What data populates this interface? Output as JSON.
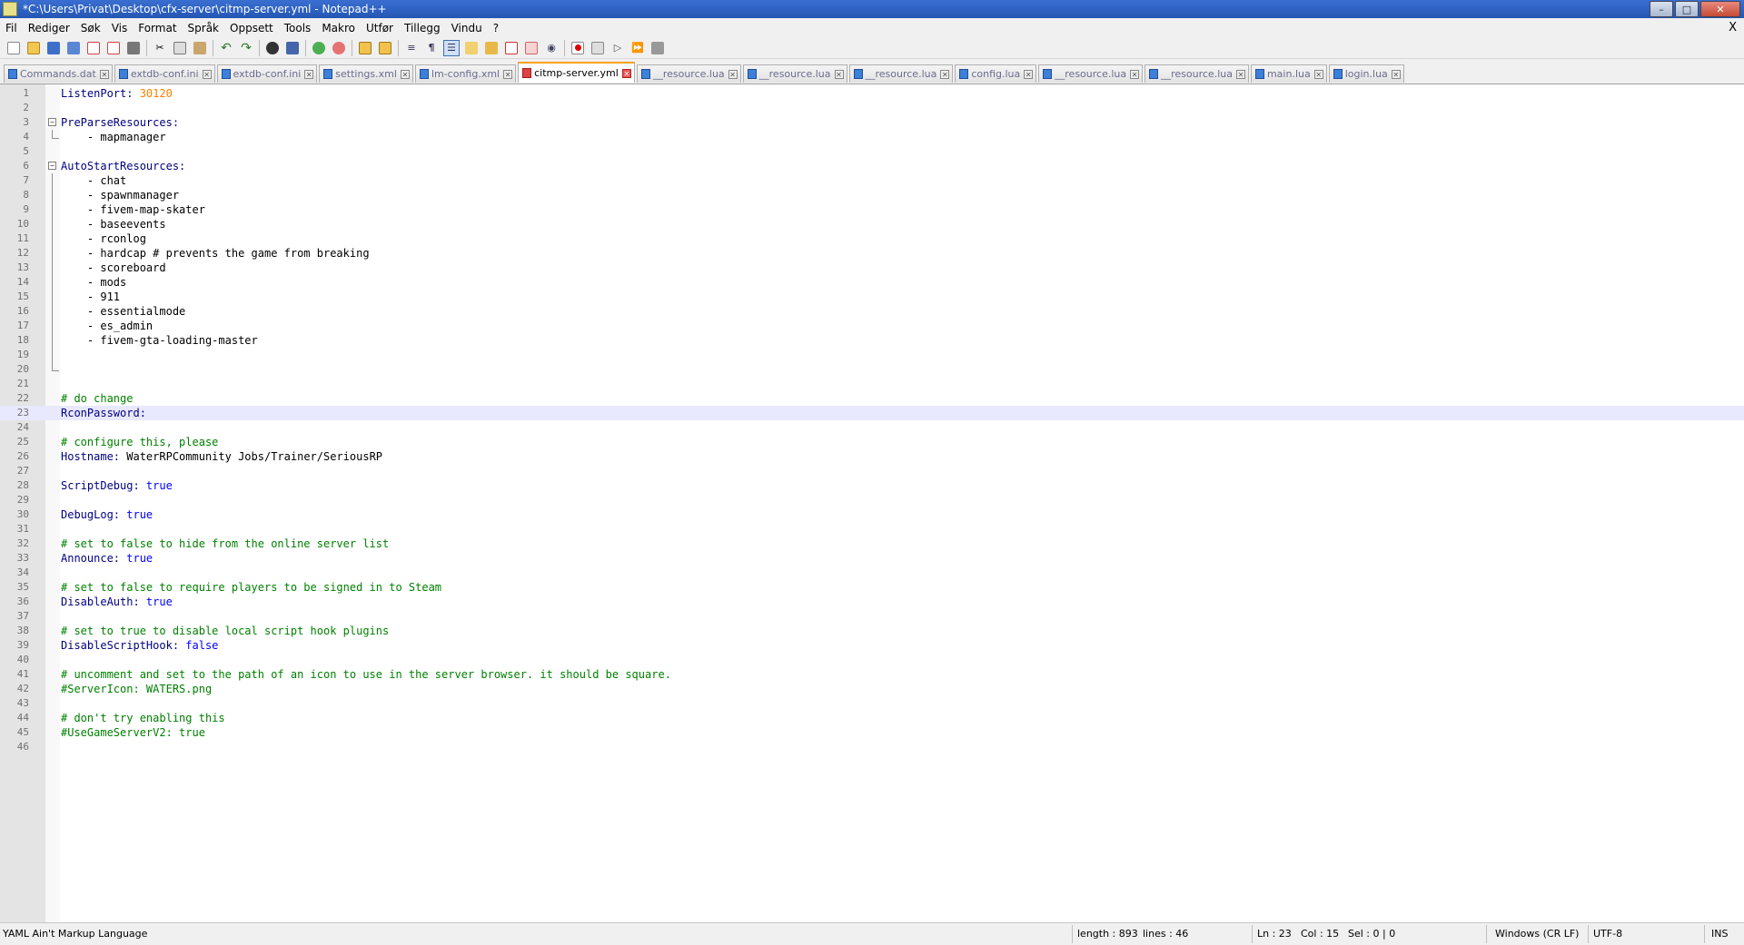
{
  "window": {
    "title": "*C:\\Users\\Privat\\Desktop\\cfx-server\\citmp-server.yml - Notepad++",
    "minimize": "–",
    "maximize": "□",
    "close": "✕"
  },
  "menu": {
    "items": [
      "Fil",
      "Rediger",
      "Søk",
      "Vis",
      "Format",
      "Språk",
      "Oppsett",
      "Tools",
      "Makro",
      "Utfør",
      "Tillegg",
      "Vindu",
      "?"
    ],
    "close": "X"
  },
  "toolbar": {
    "icons": [
      "new-file-icon",
      "open-file-icon",
      "save-icon",
      "save-all-icon",
      "close-icon",
      "close-all-icon",
      "print-icon",
      "cut-icon",
      "copy-icon",
      "paste-icon",
      "undo-icon",
      "redo-icon",
      "find-icon",
      "replace-icon",
      "zoom-in-icon",
      "zoom-out-icon",
      "sync-vertical-icon",
      "sync-horizontal-icon",
      "word-wrap-icon",
      "show-all-chars-icon",
      "indent-guide-icon",
      "doc-map-icon",
      "function-list-icon",
      "folder-workspace-icon",
      "monitoring-icon",
      "record-macro-icon",
      "stop-macro-icon",
      "play-macro-icon",
      "run-macro-multiple-icon",
      "save-macro-icon"
    ]
  },
  "tabs": [
    {
      "label": "Commands.dat",
      "active": false
    },
    {
      "label": "extdb-conf.ini",
      "active": false
    },
    {
      "label": "extdb-conf.ini",
      "active": false
    },
    {
      "label": "settings.xml",
      "active": false
    },
    {
      "label": "lm-config.xml",
      "active": false
    },
    {
      "label": "citmp-server.yml",
      "active": true
    },
    {
      "label": "__resource.lua",
      "active": false
    },
    {
      "label": "__resource.lua",
      "active": false
    },
    {
      "label": "__resource.lua",
      "active": false
    },
    {
      "label": "config.lua",
      "active": false
    },
    {
      "label": "__resource.lua",
      "active": false
    },
    {
      "label": "__resource.lua",
      "active": false
    },
    {
      "label": "main.lua",
      "active": false
    },
    {
      "label": "login.lua",
      "active": false
    }
  ],
  "editor": {
    "current_line": 23,
    "lines": [
      {
        "n": "1",
        "k": "ListenPort:",
        "v": "",
        "num": " 30120"
      },
      {
        "n": "2"
      },
      {
        "n": "3",
        "k": "PreParseResources:",
        "fold": "start"
      },
      {
        "n": "4",
        "v": "    - mapmanager",
        "fold": "end"
      },
      {
        "n": "5"
      },
      {
        "n": "6",
        "k": "AutoStartResources:",
        "fold": "start"
      },
      {
        "n": "7",
        "v": "    - chat",
        "fold": "line"
      },
      {
        "n": "8",
        "v": "    - spawnmanager",
        "fold": "line"
      },
      {
        "n": "9",
        "v": "    - fivem-map-skater",
        "fold": "line"
      },
      {
        "n": "10",
        "v": "    - baseevents",
        "fold": "line"
      },
      {
        "n": "11",
        "v": "    - rconlog",
        "fold": "line"
      },
      {
        "n": "12",
        "v": "    - hardcap # prevents the game from breaking",
        "fold": "line"
      },
      {
        "n": "13",
        "v": "    - scoreboard",
        "fold": "line"
      },
      {
        "n": "14",
        "v": "    - mods",
        "fold": "line"
      },
      {
        "n": "15",
        "v": "    - 911",
        "fold": "line"
      },
      {
        "n": "16",
        "v": "    - essentialmode",
        "fold": "line"
      },
      {
        "n": "17",
        "v": "    - es_admin",
        "fold": "line"
      },
      {
        "n": "18",
        "v": "    - fivem-gta-loading-master",
        "fold": "line"
      },
      {
        "n": "19",
        "fold": "line"
      },
      {
        "n": "20",
        "fold": "end"
      },
      {
        "n": "21"
      },
      {
        "n": "22",
        "c": "# do change"
      },
      {
        "n": "23",
        "k": "RconPassword:"
      },
      {
        "n": "24"
      },
      {
        "n": "25",
        "c": "# configure this, please"
      },
      {
        "n": "26",
        "k": "Hostname:",
        "v": " WaterRPCommunity Jobs/Trainer/SeriousRP"
      },
      {
        "n": "27"
      },
      {
        "n": "28",
        "k": "ScriptDebug:",
        "b": " true"
      },
      {
        "n": "29"
      },
      {
        "n": "30",
        "k": "DebugLog:",
        "b": " true"
      },
      {
        "n": "31"
      },
      {
        "n": "32",
        "c": "# set to false to hide from the online server list"
      },
      {
        "n": "33",
        "k": "Announce:",
        "b": " true"
      },
      {
        "n": "34"
      },
      {
        "n": "35",
        "c": "# set to false to require players to be signed in to Steam"
      },
      {
        "n": "36",
        "k": "DisableAuth:",
        "b": " true"
      },
      {
        "n": "37"
      },
      {
        "n": "38",
        "c": "# set to true to disable local script hook plugins"
      },
      {
        "n": "39",
        "k": "DisableScriptHook:",
        "b": " false"
      },
      {
        "n": "40"
      },
      {
        "n": "41",
        "c": "# uncomment and set to the path of an icon to use in the server browser. it should be square."
      },
      {
        "n": "42",
        "c": "#ServerIcon: WATERS.png"
      },
      {
        "n": "43"
      },
      {
        "n": "44",
        "c": "# don't try enabling this"
      },
      {
        "n": "45",
        "c": "#UseGameServerV2: true"
      },
      {
        "n": "46"
      }
    ]
  },
  "status": {
    "language": "YAML Ain't Markup Language",
    "length": "length : 893",
    "lines": "lines : 46",
    "ln": "Ln : 23",
    "col": "Col : 15",
    "sel": "Sel : 0 | 0",
    "eol": "Windows (CR LF)",
    "encoding": "UTF-8",
    "mode": "INS"
  }
}
